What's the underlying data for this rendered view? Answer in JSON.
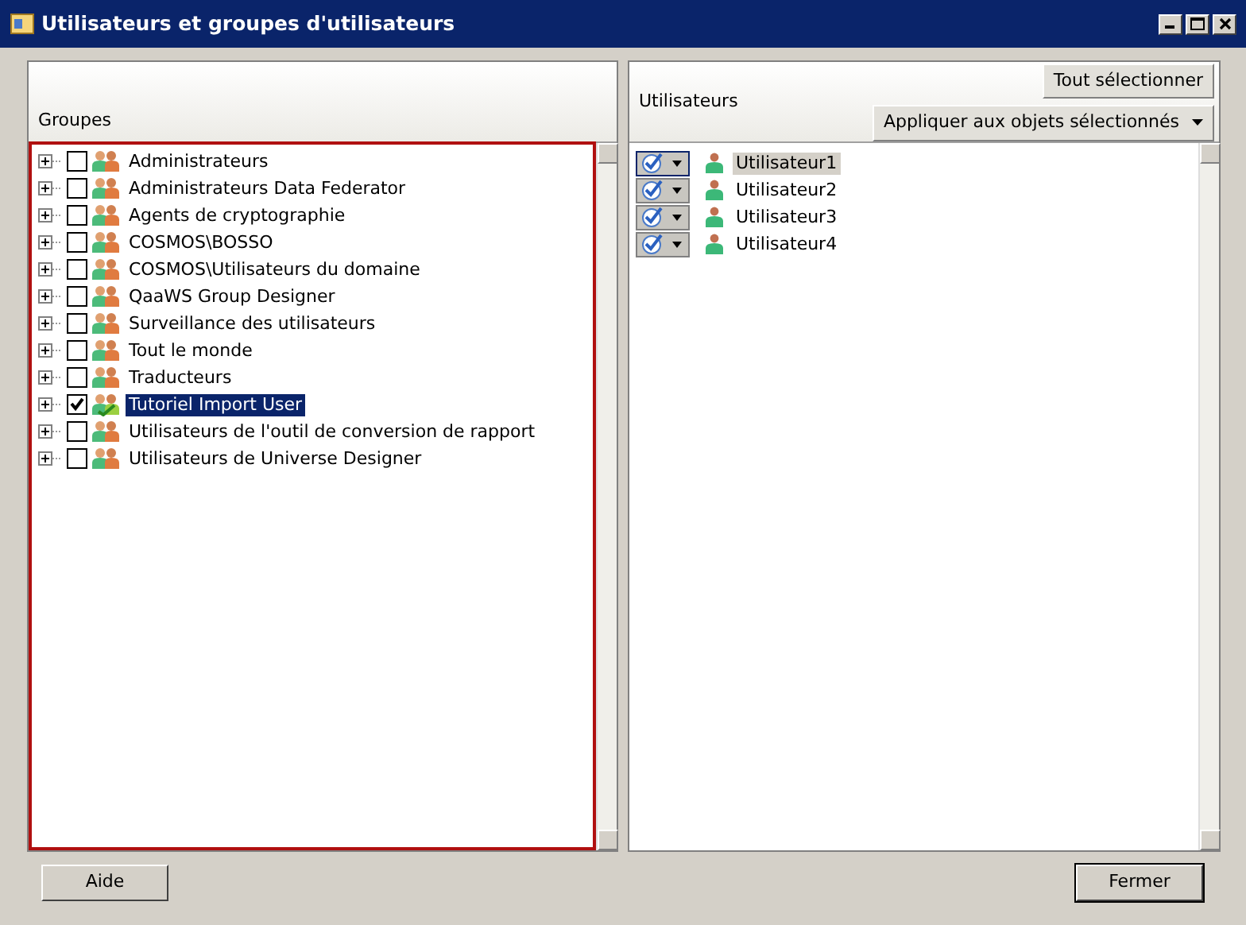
{
  "window": {
    "title": "Utilisateurs et groupes d'utilisateurs"
  },
  "groups_panel": {
    "header": "Groupes",
    "items": [
      {
        "label": "Administrateurs",
        "checked": false,
        "selected": false
      },
      {
        "label": "Administrateurs Data Federator",
        "checked": false,
        "selected": false
      },
      {
        "label": "Agents de cryptographie",
        "checked": false,
        "selected": false
      },
      {
        "label": "COSMOS\\BOSSO",
        "checked": false,
        "selected": false
      },
      {
        "label": "COSMOS\\Utilisateurs du domaine",
        "checked": false,
        "selected": false
      },
      {
        "label": "QaaWS Group Designer",
        "checked": false,
        "selected": false
      },
      {
        "label": "Surveillance des utilisateurs",
        "checked": false,
        "selected": false
      },
      {
        "label": "Tout le monde",
        "checked": false,
        "selected": false
      },
      {
        "label": "Traducteurs",
        "checked": false,
        "selected": false
      },
      {
        "label": "Tutoriel Import User",
        "checked": true,
        "selected": true
      },
      {
        "label": "Utilisateurs de l'outil de conversion de rapport",
        "checked": false,
        "selected": false
      },
      {
        "label": "Utilisateurs de Universe Designer",
        "checked": false,
        "selected": false
      }
    ]
  },
  "users_panel": {
    "header": "Utilisateurs",
    "select_all_button": "Tout sélectionner",
    "apply_button": "Appliquer aux objets sélectionnés",
    "items": [
      {
        "label": "Utilisateur1",
        "checked": true,
        "selected": true
      },
      {
        "label": "Utilisateur2",
        "checked": true,
        "selected": false
      },
      {
        "label": "Utilisateur3",
        "checked": true,
        "selected": false
      },
      {
        "label": "Utilisateur4",
        "checked": true,
        "selected": false
      }
    ]
  },
  "buttons": [
    "Aide",
    "Fermer"
  ]
}
